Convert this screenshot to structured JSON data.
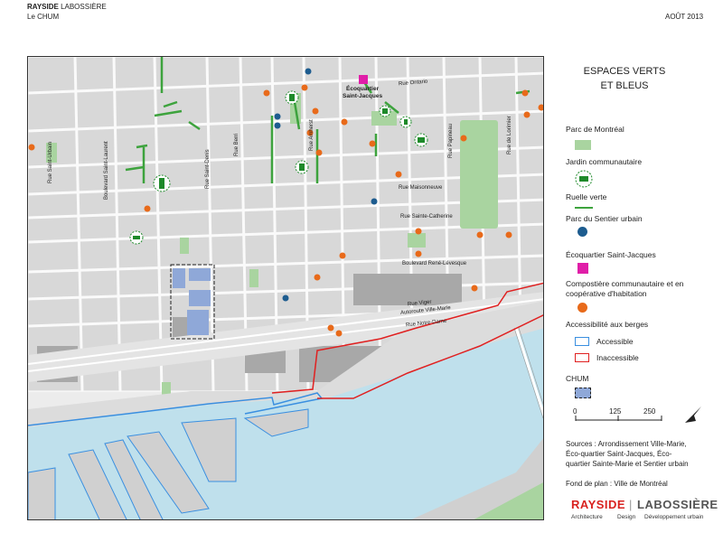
{
  "header": {
    "company_bold": "RAYSIDE",
    "company_rest": "LABOSSIÈRE",
    "subtitle": "Le CHUM",
    "date": "AOÛT 2013"
  },
  "streets": {
    "saint_urbain": "Rue Saint-Urbain",
    "saint_laurent": "Boulevard Saint-Laurent",
    "saint_denis": "Rue Saint-Denis",
    "berri": "Rue Berri",
    "amherst": "Rue Amherst",
    "papineau": "Rue Papineau",
    "de_lorimier": "Rue de Lorimier",
    "ontario": "Rue Ontario",
    "maisonneuve": "Rue Maisonneuve",
    "sainte_catherine": "Rue Sainte-Catherine",
    "rene_levesque": "Boulevard René-Lévesque",
    "viger": "Rue Viger",
    "ville_marie": "Autoroute Ville-Marie",
    "notre_dame": "Rue Notre-Dame",
    "ecoquartier_label_1": "Écoquartier",
    "ecoquartier_label_2": "Saint-Jacques"
  },
  "legend": {
    "title_1": "ESPACES VERTS",
    "title_2": "ET BLEUS",
    "parc": "Parc de Montréal",
    "jardin": "Jardin communautaire",
    "ruelle": "Ruelle verte",
    "sentier": "Parc du Sentier urbain",
    "ecoquartier": "Écoquartier Saint-Jacques",
    "compostiere_1": "Compostière communautaire et en",
    "compostiere_2": "coopérative d'habitation",
    "berges": "Accessibilité aux berges",
    "accessible": "Accessible",
    "inaccessible": "Inaccessible",
    "chum": "CHUM",
    "scale_0": "0",
    "scale_125": "125",
    "scale_250": "250",
    "sources_1": "Sources : Arrondissement Ville-Marie,",
    "sources_2": "Éco-quartier Saint-Jacques, Éco-",
    "sources_3": "quartier Sainte-Marie et Sentier urbain",
    "fond": "Fond de plan : Ville de Montréal"
  },
  "brand": {
    "name_1": "RAYSIDE",
    "name_2": "LABOSSIÈRE",
    "tag_1": "Architecture",
    "tag_2": "Design",
    "tag_3": "Développement urbain"
  },
  "colors": {
    "park": "#a9d4a0",
    "garden": "#1e8a2a",
    "ruelle": "#3da33d",
    "sentier": "#1d5c8f",
    "ecoquartier": "#e01ea8",
    "compost": "#e86a1a",
    "accessible": "#3a8fe0",
    "inaccessible": "#e02020",
    "chum": "#8fa8d8",
    "water": "#bfe0ec"
  }
}
